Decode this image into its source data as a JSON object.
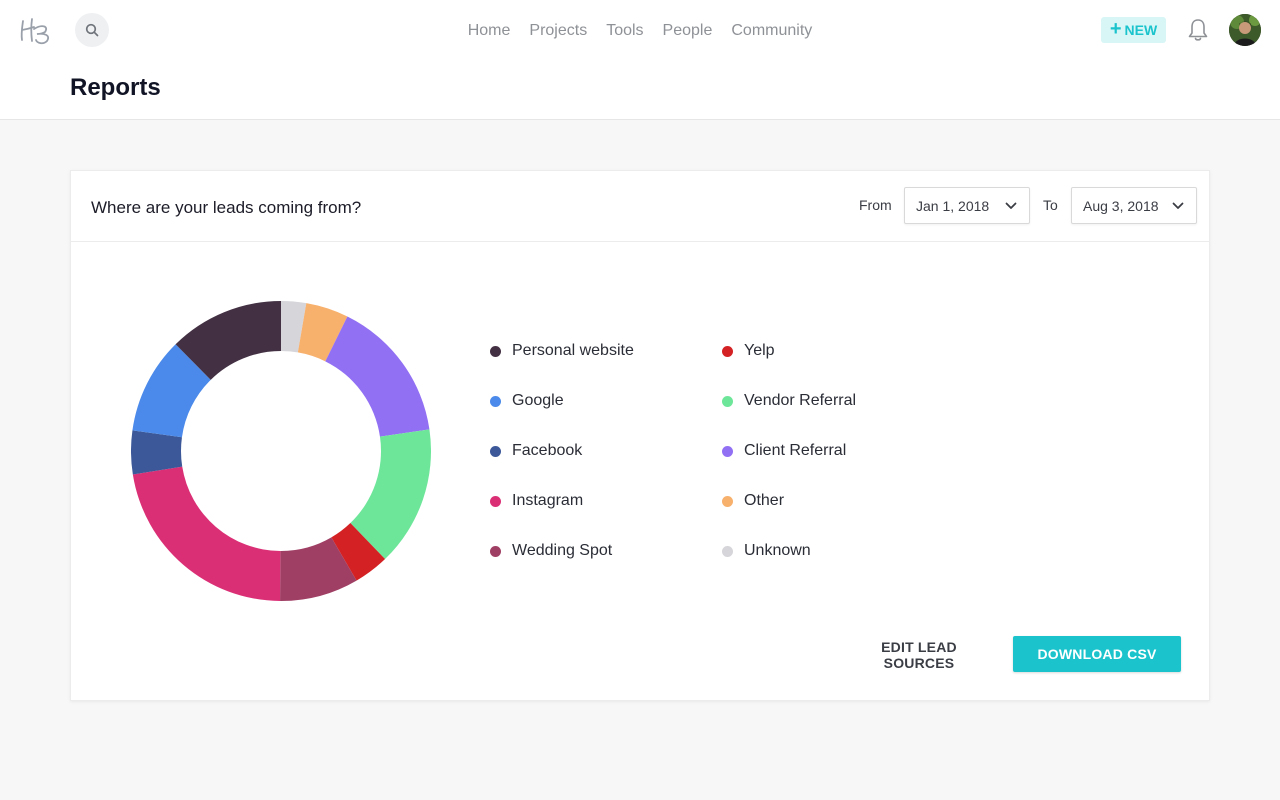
{
  "nav": {
    "items": [
      {
        "label": "Home",
        "name": "nav-home"
      },
      {
        "label": "Projects",
        "name": "nav-projects"
      },
      {
        "label": "Tools",
        "name": "nav-tools"
      },
      {
        "label": "People",
        "name": "nav-people"
      },
      {
        "label": "Community",
        "name": "nav-community"
      }
    ],
    "new_label": "NEW"
  },
  "page": {
    "title": "Reports"
  },
  "report": {
    "title": "Where are your leads coming from?",
    "from_label": "From",
    "from_value": "Jan 1, 2018",
    "to_label": "To",
    "to_value": "Aug 3, 2018",
    "edit_label": "EDIT LEAD SOURCES",
    "download_label": "DOWNLOAD CSV"
  },
  "chart_data": {
    "type": "pie",
    "variant": "donut",
    "title": "",
    "legend": "right",
    "series": [
      {
        "name": "Unknown",
        "value": 2.7,
        "color": "#d5d5da"
      },
      {
        "name": "Other",
        "value": 4.6,
        "color": "#f8b06d"
      },
      {
        "name": "Client Referral",
        "value": 15.4,
        "color": "#9270f4"
      },
      {
        "name": "Vendor Referral",
        "value": 15.1,
        "color": "#6ee69a"
      },
      {
        "name": "Yelp",
        "value": 3.8,
        "color": "#d42224"
      },
      {
        "name": "Wedding Spot",
        "value": 8.5,
        "color": "#a03f64"
      },
      {
        "name": "Instagram",
        "value": 22.4,
        "color": "#db2f75"
      },
      {
        "name": "Facebook",
        "value": 4.7,
        "color": "#3c5899"
      },
      {
        "name": "Google",
        "value": 10.4,
        "color": "#4b8aea"
      },
      {
        "name": "Personal website",
        "value": 12.4,
        "color": "#433143"
      }
    ],
    "legend_order": [
      "Personal website",
      "Google",
      "Facebook",
      "Instagram",
      "Wedding Spot",
      "Yelp",
      "Vendor Referral",
      "Client Referral",
      "Other",
      "Unknown"
    ]
  }
}
